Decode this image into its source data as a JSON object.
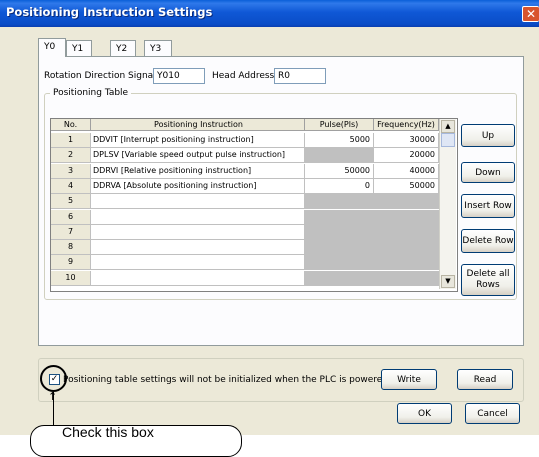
{
  "window": {
    "title": "Positioning Instruction Settings",
    "close_glyph": "✕"
  },
  "tabs": [
    "Y0",
    "Y1",
    "Y2",
    "Y3"
  ],
  "form": {
    "rotation_label": "Rotation Direction Signal",
    "rotation_value": "Y010",
    "head_label": "Head Address",
    "head_value": "R0"
  },
  "group_title": "Positioning Table",
  "table": {
    "headers": [
      "No.",
      "Positioning Instruction",
      "Pulse(Pls)",
      "Frequency(Hz)"
    ],
    "rows": [
      {
        "no": "1",
        "instruction": "DDVIT [Interrupt positioning instruction]",
        "pulse": "5000",
        "freq": "30000"
      },
      {
        "no": "2",
        "instruction": "DPLSV [Variable speed output pulse instruction]",
        "pulse": "",
        "freq": "20000"
      },
      {
        "no": "3",
        "instruction": "DDRVI [Relative positioning instruction]",
        "pulse": "50000",
        "freq": "40000"
      },
      {
        "no": "4",
        "instruction": "DDRVA [Absolute positioning instruction]",
        "pulse": "0",
        "freq": "50000"
      },
      {
        "no": "5",
        "instruction": "",
        "pulse": "",
        "freq": ""
      },
      {
        "no": "6",
        "instruction": "",
        "pulse": "",
        "freq": ""
      },
      {
        "no": "7",
        "instruction": "",
        "pulse": "",
        "freq": ""
      },
      {
        "no": "8",
        "instruction": "",
        "pulse": "",
        "freq": ""
      },
      {
        "no": "9",
        "instruction": "",
        "pulse": "",
        "freq": ""
      },
      {
        "no": "10",
        "instruction": "",
        "pulse": "",
        "freq": ""
      }
    ]
  },
  "side_buttons": {
    "up": "Up",
    "down": "Down",
    "insert": "Insert Row",
    "delete": "Delete Row",
    "delete_all": "Delete all Rows"
  },
  "bottom": {
    "checkbox_label": "Positioning table settings will not be initialized when the PLC is powered on",
    "checkbox_checked": true,
    "write": "Write",
    "read": "Read",
    "ok": "OK",
    "cancel": "Cancel"
  },
  "callout": {
    "text": "Check this box"
  },
  "icons": {
    "dropdown": "dropdown-arrow-icon",
    "scroll_up": "scroll-up-icon",
    "scroll_down": "scroll-down-icon",
    "check": "checkmark-icon",
    "arrow": "arrow-up-icon"
  }
}
